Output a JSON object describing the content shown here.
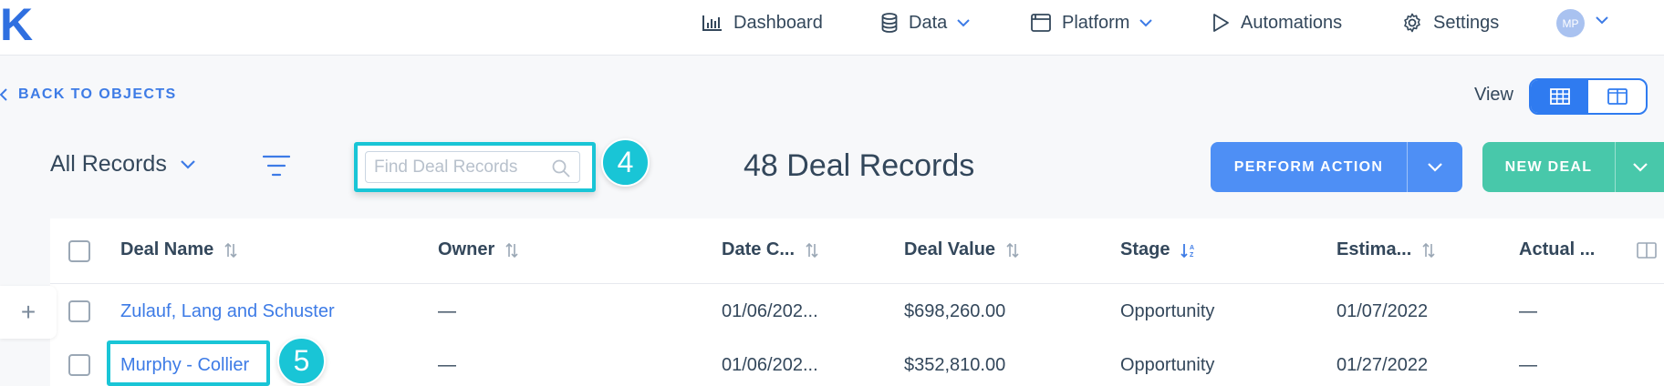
{
  "nav": {
    "logo": "K",
    "items": [
      {
        "label": "Dashboard",
        "icon": "bar-chart-icon"
      },
      {
        "label": "Data",
        "icon": "database-icon",
        "has_dropdown": true
      },
      {
        "label": "Platform",
        "icon": "window-icon",
        "has_dropdown": true
      },
      {
        "label": "Automations",
        "icon": "play-icon"
      },
      {
        "label": "Settings",
        "icon": "gear-icon"
      }
    ],
    "avatar_initials": "MP"
  },
  "subheader": {
    "back_label": "BACK TO OBJECTS",
    "view_label": "View"
  },
  "toolbar": {
    "records_filter": "All Records",
    "search_placeholder": "Find Deal Records",
    "search_step": "4",
    "record_count": "48 Deal Records",
    "perform_action": "PERFORM ACTION",
    "new_deal": "NEW DEAL"
  },
  "table": {
    "columns": [
      "Deal Name",
      "Owner",
      "Date C...",
      "Deal Value",
      "Stage",
      "Estima...",
      "Actual ..."
    ],
    "rows": [
      {
        "deal_name": "Zulauf, Lang and Schuster",
        "owner": "—",
        "date_created": "01/06/202...",
        "deal_value": "$698,260.00",
        "stage": "Opportunity",
        "estimated": "01/07/2022",
        "actual": "—"
      },
      {
        "deal_name": "Murphy - Collier",
        "owner": "—",
        "date_created": "01/06/202...",
        "deal_value": "$352,810.00",
        "stage": "Opportunity",
        "estimated": "01/27/2022",
        "actual": "—"
      }
    ],
    "row_step": "5"
  },
  "colors": {
    "accent": "#2f7bf0",
    "highlight": "#19c5d6",
    "new_button": "#48c8aa",
    "link": "#3d7be6"
  }
}
